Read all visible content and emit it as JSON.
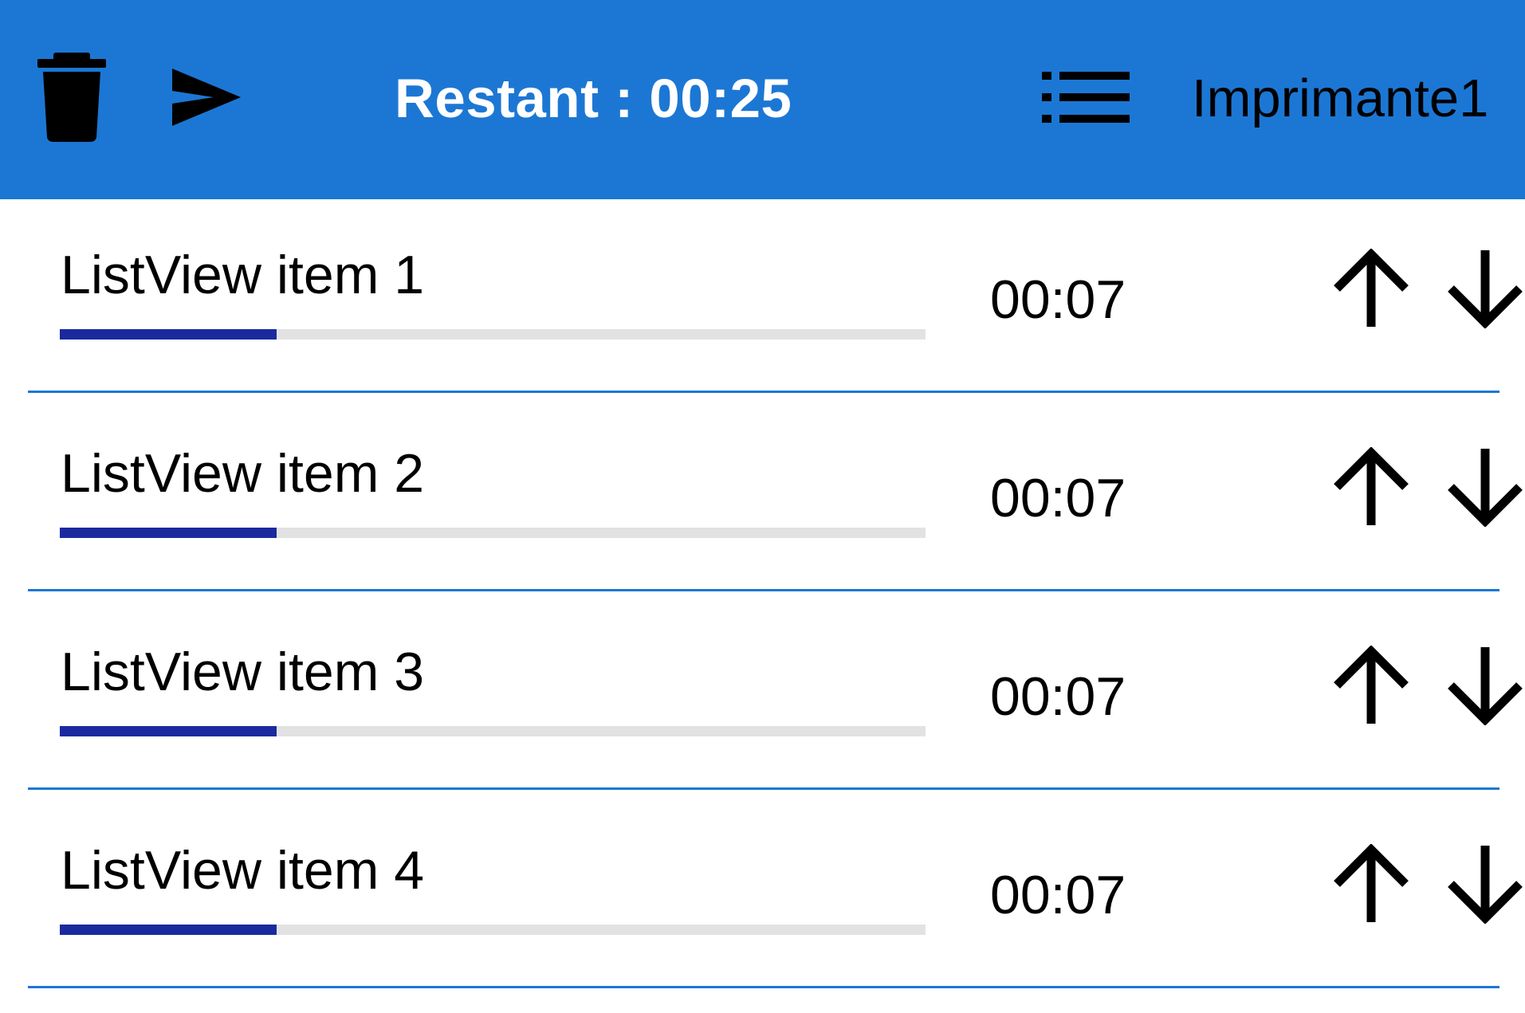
{
  "colors": {
    "app_bar": "#1c77d4",
    "progress_fill": "#1a2a9e",
    "progress_track": "#e2e2e2",
    "divider": "#1c77d4"
  },
  "header": {
    "delete_icon": "trash-icon",
    "send_icon": "send-icon",
    "remaining_label": "Restant : 00:25",
    "menu_icon": "list-menu-icon",
    "printer_label": "Imprimante1"
  },
  "list": {
    "items": [
      {
        "label": "ListView item 1",
        "time": "00:07",
        "progress": 0.25
      },
      {
        "label": "ListView item 2",
        "time": "00:07",
        "progress": 0.25
      },
      {
        "label": "ListView item 3",
        "time": "00:07",
        "progress": 0.25
      },
      {
        "label": "ListView item 4",
        "time": "00:07",
        "progress": 0.25
      }
    ],
    "up_icon": "arrow-up-icon",
    "down_icon": "arrow-down-icon"
  }
}
